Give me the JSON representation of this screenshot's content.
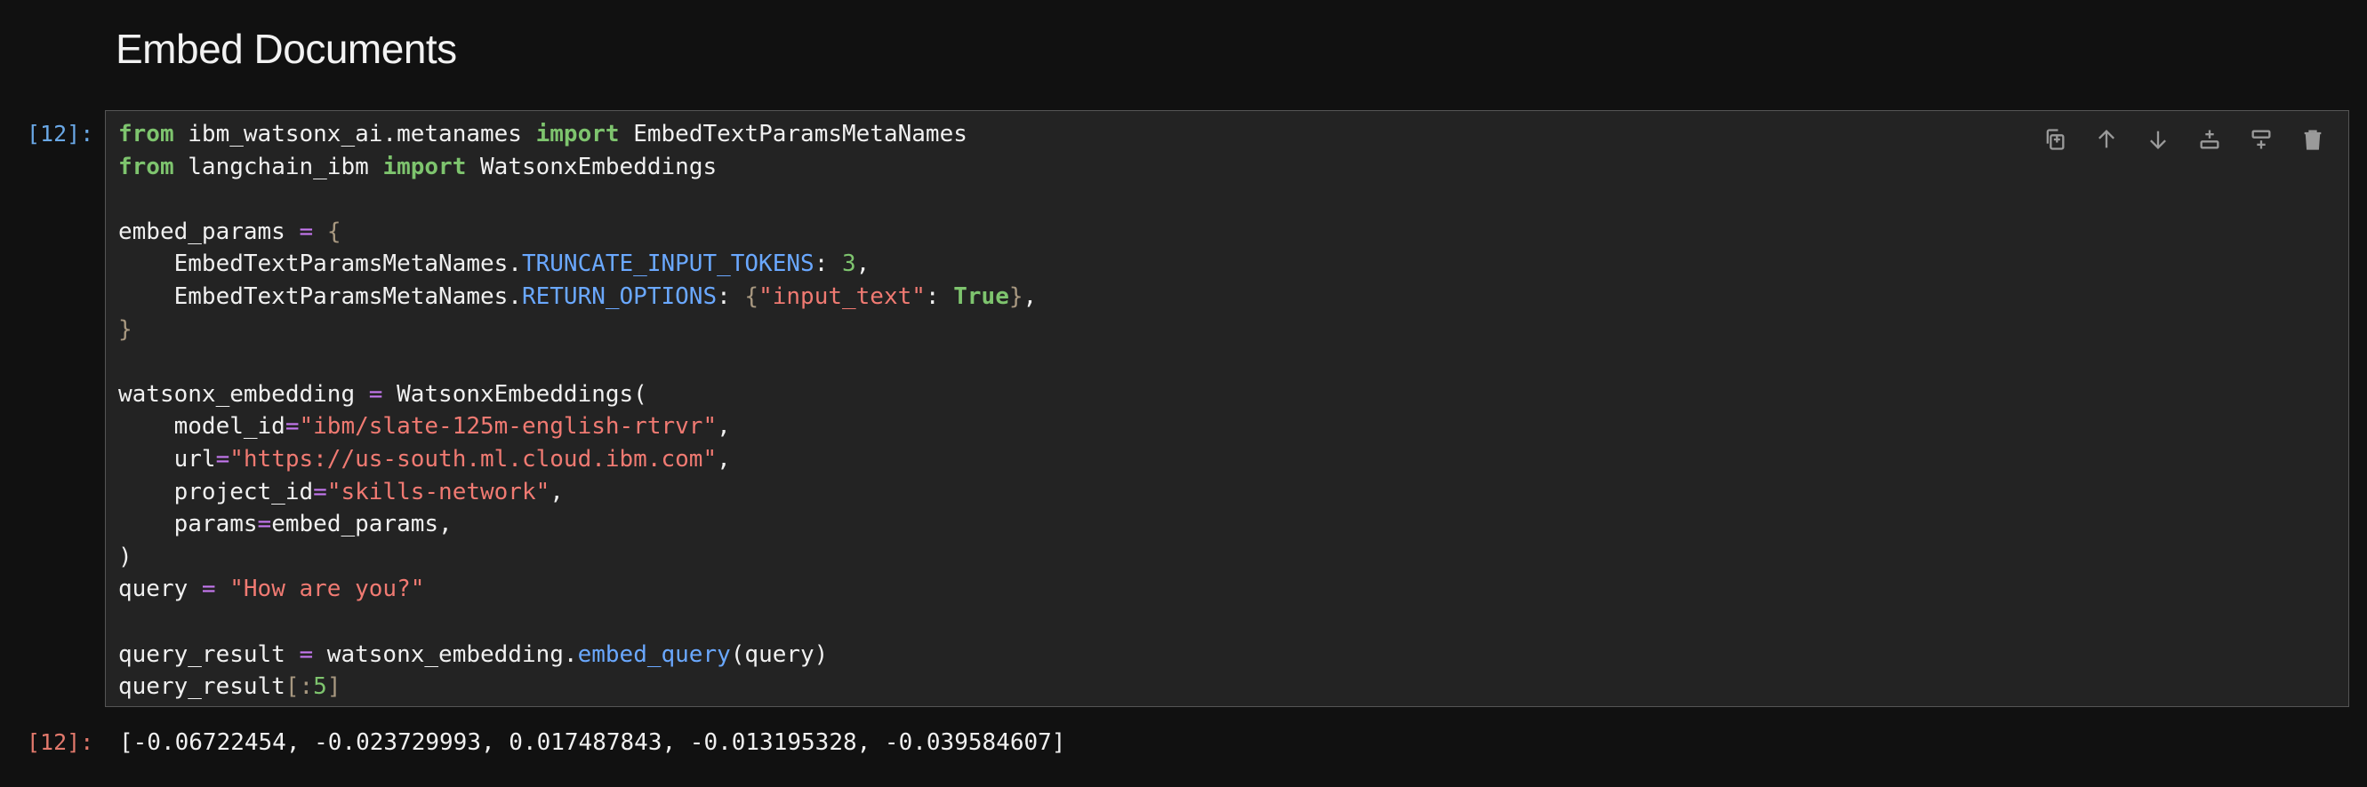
{
  "heading": "Embed Documents",
  "input_prompt": "[12]:",
  "output_prompt": "[12]:",
  "toolbar": {
    "icons": [
      "duplicate-icon",
      "move-up-icon",
      "move-down-icon",
      "insert-below-icon",
      "insert-above-icon",
      "delete-icon"
    ]
  },
  "code": {
    "l1": {
      "t0": "from",
      "t1": " ibm_watsonx_ai.metanames ",
      "t2": "import",
      "t3": " EmbedTextParamsMetaNames"
    },
    "l2": {
      "t0": "from",
      "t1": " langchain_ibm ",
      "t2": "import",
      "t3": " WatsonxEmbeddings"
    },
    "l4": {
      "t0": "embed_params ",
      "t1": "=",
      "t2": " ",
      "t3": "{"
    },
    "l5": {
      "t0": "    EmbedTextParamsMetaNames.",
      "t1": "TRUNCATE_INPUT_TOKENS",
      "t2": ": ",
      "t3": "3",
      "t4": ","
    },
    "l6": {
      "t0": "    EmbedTextParamsMetaNames.",
      "t1": "RETURN_OPTIONS",
      "t2": ": ",
      "t3": "{",
      "t4": "\"input_text\"",
      "t5": ": ",
      "t6": "True",
      "t7": "}",
      "t8": ","
    },
    "l7": {
      "t0": "}"
    },
    "l9": {
      "t0": "watsonx_embedding ",
      "t1": "=",
      "t2": " WatsonxEmbeddings("
    },
    "l10": {
      "t0": "    model_id",
      "t1": "=",
      "t2": "\"ibm/slate-125m-english-rtrvr\"",
      "t3": ","
    },
    "l11": {
      "t0": "    url",
      "t1": "=",
      "t2": "\"https://us-south.ml.cloud.ibm.com\"",
      "t3": ","
    },
    "l12": {
      "t0": "    project_id",
      "t1": "=",
      "t2": "\"skills-network\"",
      "t3": ","
    },
    "l13": {
      "t0": "    params",
      "t1": "=",
      "t2": "embed_params,"
    },
    "l14": {
      "t0": ")"
    },
    "l15": {
      "t0": "query ",
      "t1": "=",
      "t2": " ",
      "t3": "\"How are you?\""
    },
    "l17": {
      "t0": "query_result ",
      "t1": "=",
      "t2": " watsonx_embedding.",
      "t3": "embed_query",
      "t4": "(query)"
    },
    "l18": {
      "t0": "query_result",
      "t1": "[:",
      "t2": "5",
      "t3": "]"
    }
  },
  "output": "[-0.06722454, -0.023729993, 0.017487843, -0.013195328, -0.039584607]"
}
